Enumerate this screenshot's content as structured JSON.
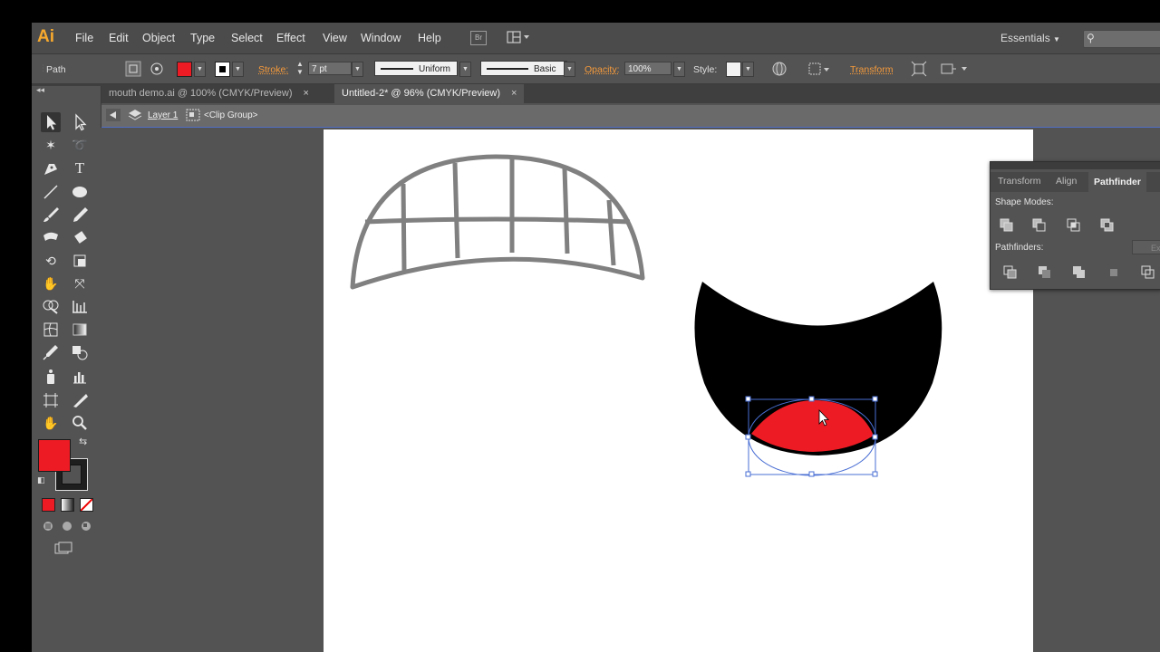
{
  "app": {
    "logo": "Ai"
  },
  "menu": {
    "items": [
      "File",
      "Edit",
      "Object",
      "Type",
      "Select",
      "Effect",
      "View",
      "Window",
      "Help"
    ],
    "bridge_badge": "Br",
    "workspace": "Essentials"
  },
  "control": {
    "object_type": "Path",
    "stroke_label": "Stroke:",
    "stroke_value": "7 pt",
    "profile": "Uniform",
    "brush": "Basic",
    "opacity_label": "Opacity:",
    "opacity_value": "100%",
    "style_label": "Style:",
    "transform_label": "Transform",
    "fill_color": "#ed1c24"
  },
  "tabs": [
    {
      "label": "mouth demo.ai @ 100% (CMYK/Preview)",
      "close": "×"
    },
    {
      "label": "Untitled-2* @ 96% (CMYK/Preview)",
      "close": "×"
    }
  ],
  "breadcrumb": {
    "layer": "Layer 1",
    "group": "<Clip Group>"
  },
  "panel": {
    "tabs": [
      "Transform",
      "Align",
      "Pathfinder"
    ],
    "shape_modes": "Shape Modes:",
    "pathfinders": "Pathfinders:",
    "expand": "Ex"
  },
  "colors": {
    "fill": "#ed1c24",
    "stroke": "#1e1e1e",
    "canvas": "#535353",
    "artboard": "#ffffff",
    "teeth": "#808080",
    "mouth": "#000000",
    "selection": "#4a6fd4"
  }
}
